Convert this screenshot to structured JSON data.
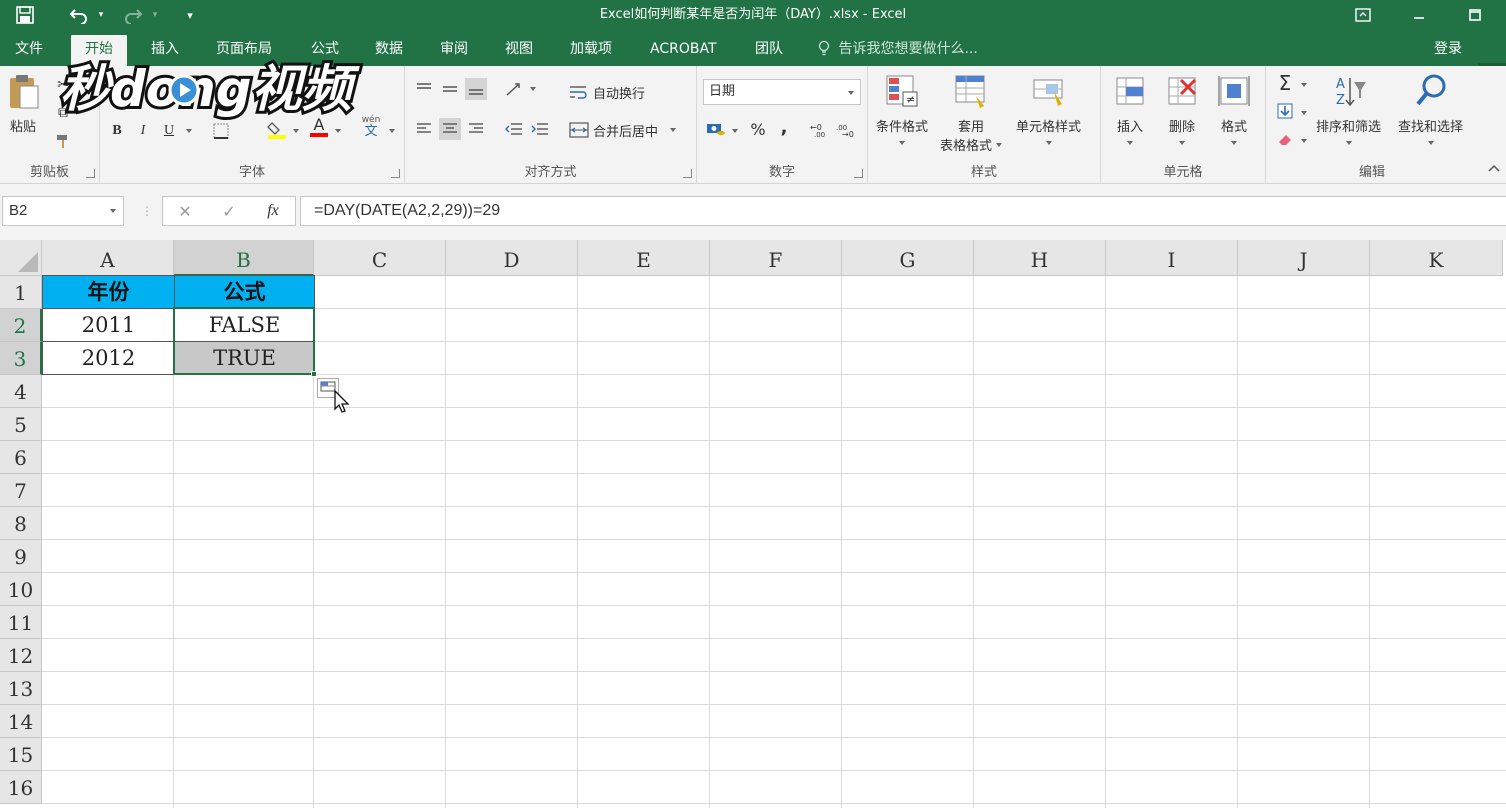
{
  "window": {
    "title": "Excel如何判断某年是否为闰年（DAY）.xlsx - Excel"
  },
  "tabs": [
    "文件",
    "开始",
    "插入",
    "页面布局",
    "公式",
    "数据",
    "审阅",
    "视图",
    "加载项",
    "ACROBAT",
    "团队"
  ],
  "active_tab": "开始",
  "tell_me": "告诉我您想要做什么...",
  "login": "登录",
  "ribbon": {
    "clipboard": {
      "label": "剪贴板",
      "paste": "粘贴"
    },
    "font": {
      "label": "字体",
      "bold": "B",
      "italic": "I",
      "underline": "U",
      "font_color": "A",
      "phonetic_top": "wén",
      "phonetic_bottom": "文"
    },
    "alignment": {
      "label": "对齐方式",
      "wrap_text": "自动换行",
      "merge_center": "合并后居中"
    },
    "number": {
      "label": "数字",
      "format": "日期",
      "percent": "%",
      "comma": ","
    },
    "styles": {
      "label": "样式",
      "conditional": "条件格式",
      "table_format_1": "套用",
      "table_format_2": "表格格式",
      "cell_styles": "单元格样式"
    },
    "cells": {
      "label": "单元格",
      "insert": "插入",
      "delete": "删除",
      "format": "格式"
    },
    "editing": {
      "label": "编辑",
      "sum": "Σ",
      "sort_filter": "排序和筛选",
      "find_select": "查找和选择"
    }
  },
  "watermark": "秒dong视频",
  "formula_bar": {
    "name_box": "B2",
    "fx": "fx",
    "formula": "=DAY(DATE(A2,2,29))=29"
  },
  "sheet": {
    "columns": [
      "A",
      "B",
      "C",
      "D",
      "E",
      "F",
      "G",
      "H",
      "I",
      "J",
      "K"
    ],
    "rows": [
      "1",
      "2",
      "3",
      "4",
      "5",
      "6",
      "7",
      "8",
      "9",
      "10",
      "11",
      "12",
      "13",
      "14",
      "15",
      "16"
    ],
    "selected_columns": [
      "B"
    ],
    "selected_rows": [
      "2",
      "3"
    ],
    "header_fill": "#00b0f0",
    "accent": "#217346",
    "cells": {
      "A1": "年份",
      "B1": "公式",
      "A2": "2011",
      "B2": "FALSE",
      "A3": "2012",
      "B3": "TRUE"
    }
  }
}
